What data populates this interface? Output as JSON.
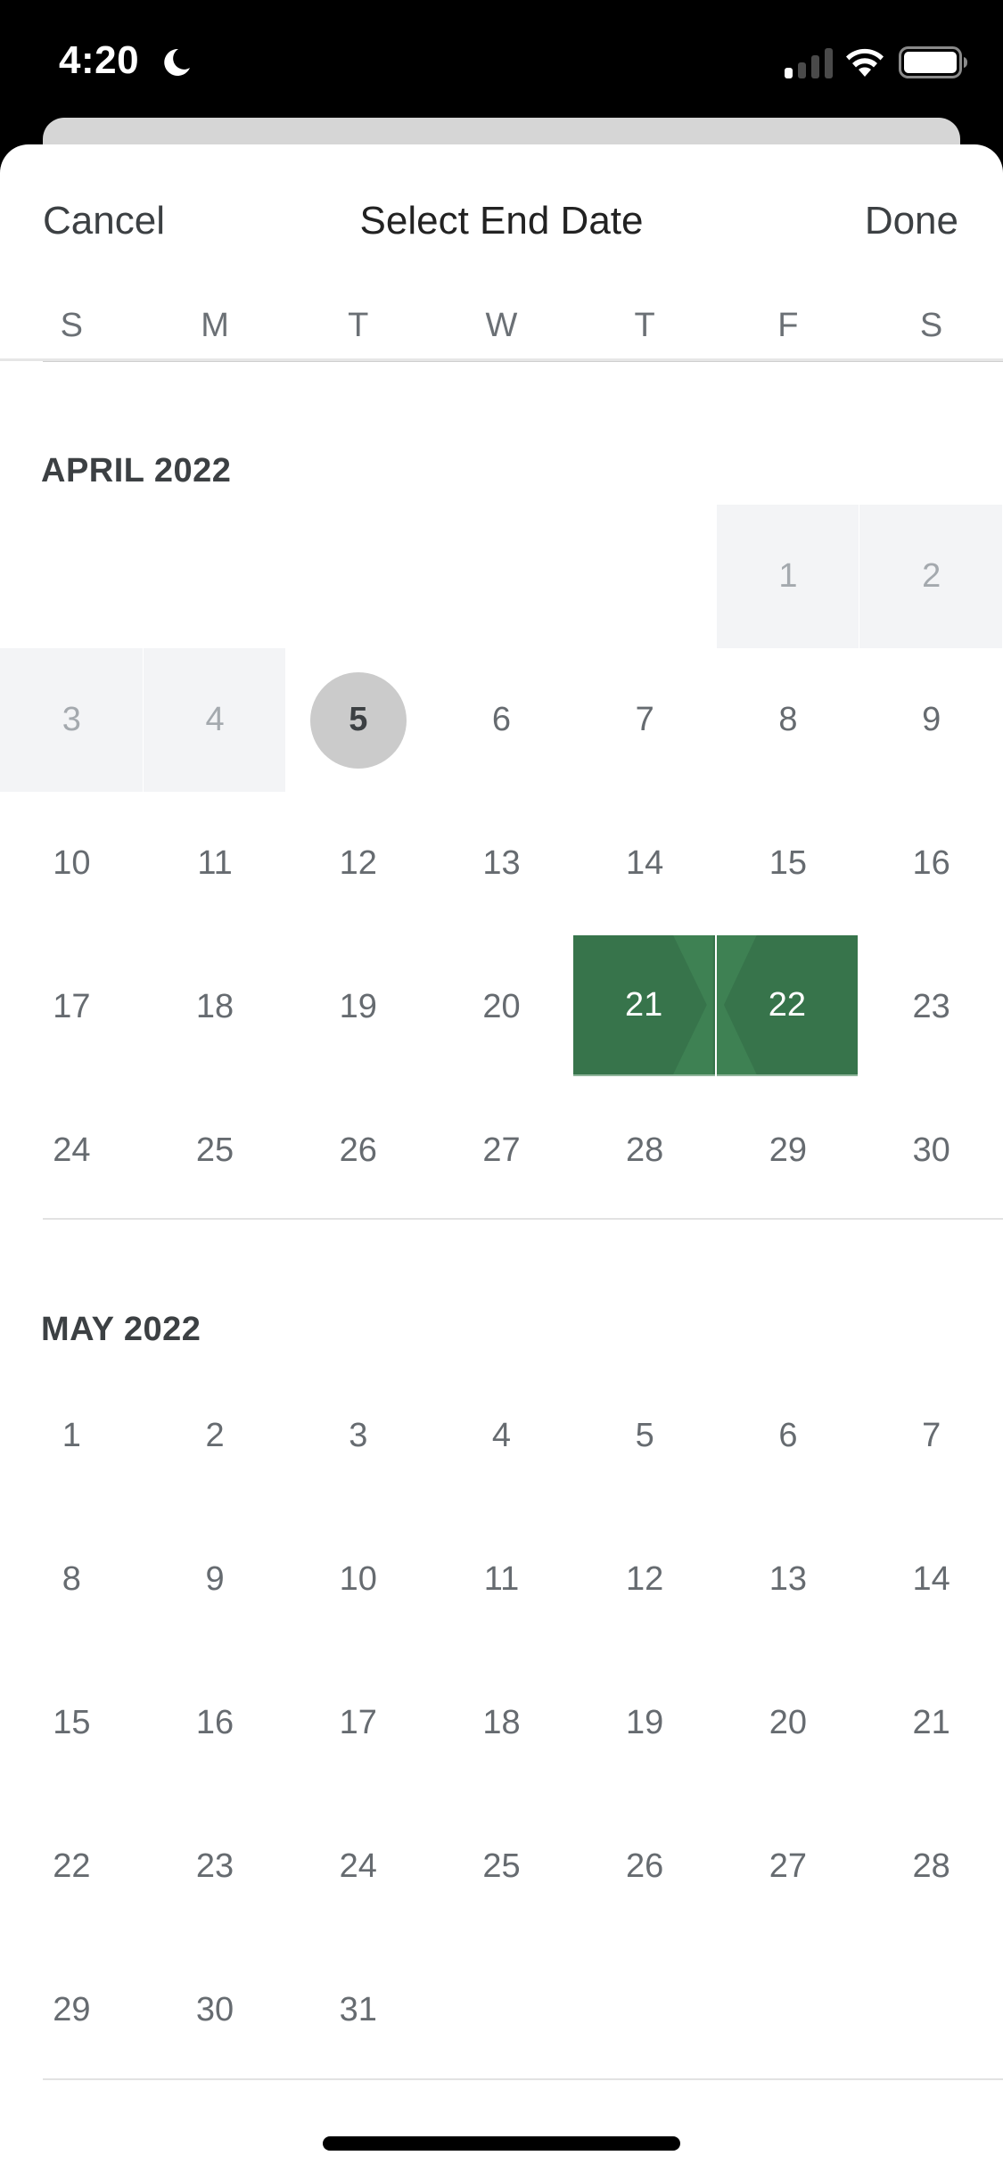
{
  "status_bar": {
    "time": "4:20",
    "focus_icon": "moon-icon",
    "signal_icon": "cellular-signal-icon",
    "signal_bars_active": 1,
    "signal_bars_total": 4,
    "wifi_icon": "wifi-icon",
    "battery_icon": "battery-icon",
    "battery_level": 1.0
  },
  "header": {
    "cancel_label": "Cancel",
    "title": "Select End Date",
    "done_label": "Done"
  },
  "weekdays": [
    "S",
    "M",
    "T",
    "W",
    "T",
    "F",
    "S"
  ],
  "colors": {
    "selected_dark": "#37744b",
    "selected_light": "#3e8153",
    "today_circle": "#cbcbcb",
    "disabled_bg": "#f3f4f6",
    "disabled_text": "#a4a9ae",
    "day_text": "#666b70"
  },
  "months": [
    {
      "label": "APRIL 2022",
      "first_weekday": 5,
      "days_in_month": 30,
      "disabled_days": [
        1,
        2,
        3,
        4
      ],
      "today": 5,
      "selected_start": 21,
      "selected_end": 22
    },
    {
      "label": "MAY 2022",
      "first_weekday": 0,
      "days_in_month": 31,
      "disabled_days": [],
      "today": null,
      "selected_start": null,
      "selected_end": null
    }
  ]
}
